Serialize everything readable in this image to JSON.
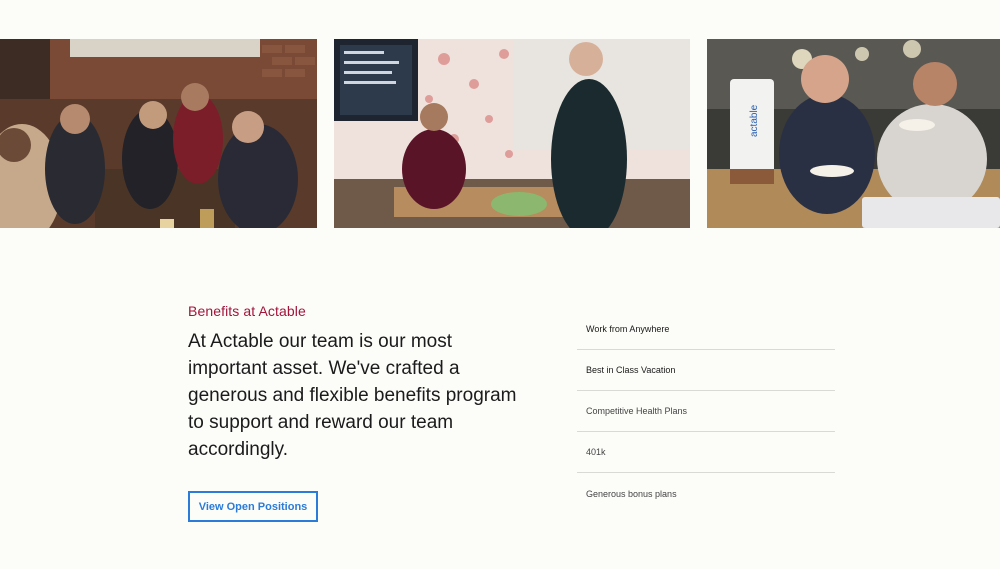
{
  "benefits_section": {
    "eyebrow": "Benefits at Actable",
    "headline": "At Actable our team is our most important asset. We've crafted a generous and flexible benefits program to support and reward our team accordingly.",
    "cta_label": "View Open Positions",
    "items": [
      "Work from Anywhere",
      "Best in Class Vacation",
      "Competitive Health Plans",
      "401k",
      "Generous bonus plans"
    ]
  },
  "photos": {
    "mug_text": "actable"
  },
  "colors": {
    "accent_red": "#a3143a",
    "link_blue": "#2b7cd8",
    "background": "#fcfcf9"
  }
}
